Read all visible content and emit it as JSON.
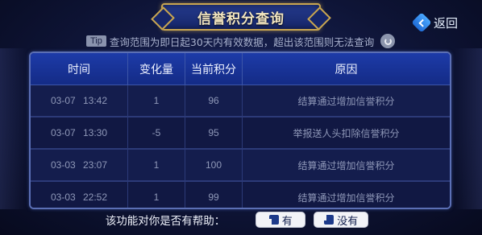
{
  "title": "信誉积分查询",
  "back_label": "返回",
  "tip": {
    "badge": "Tip",
    "text": "查询范围为即日起30天内有效数据，超出该范围则无法查询"
  },
  "table": {
    "headers": [
      "时间",
      "变化量",
      "当前积分",
      "原因"
    ],
    "rows": [
      {
        "time": "03-07 13:42",
        "change": "1",
        "score": "96",
        "reason": "结算通过增加信誉积分"
      },
      {
        "time": "03-07 13:30",
        "change": "-5",
        "score": "95",
        "reason": "举报送人头扣除信誉积分"
      },
      {
        "time": "03-03 23:07",
        "change": "1",
        "score": "100",
        "reason": "结算通过增加信誉积分"
      },
      {
        "time": "03-03 22:52",
        "change": "1",
        "score": "99",
        "reason": "结算通过增加信誉积分"
      }
    ]
  },
  "footer": {
    "question": "该功能对你是否有帮助：",
    "yes_label": "有",
    "no_label": "没有"
  },
  "colors": {
    "gold_border": "#c9a650",
    "header_blue": "#1d3ba8",
    "accent_blue": "#4aa8ff"
  }
}
